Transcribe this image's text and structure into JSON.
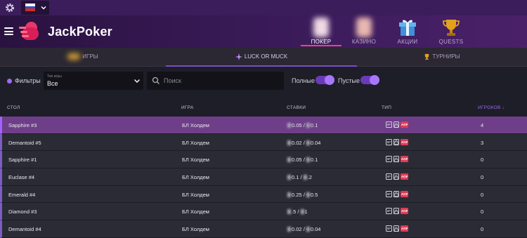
{
  "topbar": {
    "language_flag": "ru-flag",
    "settings_icon": "gear-icon"
  },
  "header": {
    "brand": "JackPoker",
    "nav": [
      {
        "label": "ПОКЕР",
        "icon": "poker-cards-icon",
        "active": true
      },
      {
        "label": "КАЗИНО",
        "icon": "casino-icon",
        "active": false
      },
      {
        "label": "АКЦИИ",
        "icon": "gift-box-icon",
        "active": false
      },
      {
        "label": "QUESTS",
        "icon": "trophy-icon",
        "active": false
      }
    ]
  },
  "tabs": [
    {
      "label": "ИГРЫ",
      "icon": "coins-icon",
      "active": false
    },
    {
      "label": "LUCK OR MUCK",
      "icon": "sparkle-icon",
      "active": true
    },
    {
      "label": "ТУРНИРЫ",
      "icon": "trophy-icon",
      "active": false
    }
  ],
  "filters": {
    "label": "Фильтры",
    "select_caption": "Тип игры",
    "select_value": "Все",
    "search_placeholder": "Поиск",
    "full_label": "Полные",
    "empty_label": "Пустые"
  },
  "table": {
    "headers": {
      "table": "СТОЛ",
      "game": "ИГРА",
      "stakes": "СТАВКИ",
      "type": "ТИП",
      "players": "ИГРОКОВ ↓"
    },
    "rows": [
      {
        "name": "Sapphire #3",
        "game": "БЛ Холдем",
        "stake_low": "0.05",
        "stake_high": "0.1",
        "players": "4",
        "selected": true
      },
      {
        "name": "Demantoid #5",
        "game": "БЛ Холдем",
        "stake_low": "0.02",
        "stake_high": "0.04",
        "players": "3",
        "selected": false
      },
      {
        "name": "Sapphire #1",
        "game": "БЛ Холдем",
        "stake_low": "0.05",
        "stake_high": "0.1",
        "players": "0",
        "selected": false
      },
      {
        "name": "Euclase #4",
        "game": "БЛ Холдем",
        "stake_low": "0.1",
        "stake_high": ".2",
        "players": "0",
        "selected": false
      },
      {
        "name": "Emerald #4",
        "game": "БЛ Холдем",
        "stake_low": "0.25",
        "stake_high": "0.5",
        "players": "0",
        "selected": false
      },
      {
        "name": "Diamond #3",
        "game": "БЛ Холдем",
        "stake_low": ".5",
        "stake_high": "1",
        "players": "0",
        "selected": false
      },
      {
        "name": "Demantoid #4",
        "game": "БЛ Холдем",
        "stake_low": "0.02",
        "stake_high": "0.04",
        "players": "0",
        "selected": false
      }
    ],
    "type_badges": {
      "six": "6P",
      "aof": "AOF"
    }
  },
  "colors": {
    "accent": "#9d6cf0",
    "selected_row": "#6e3e88",
    "nav_underline": "#e04b6b"
  }
}
